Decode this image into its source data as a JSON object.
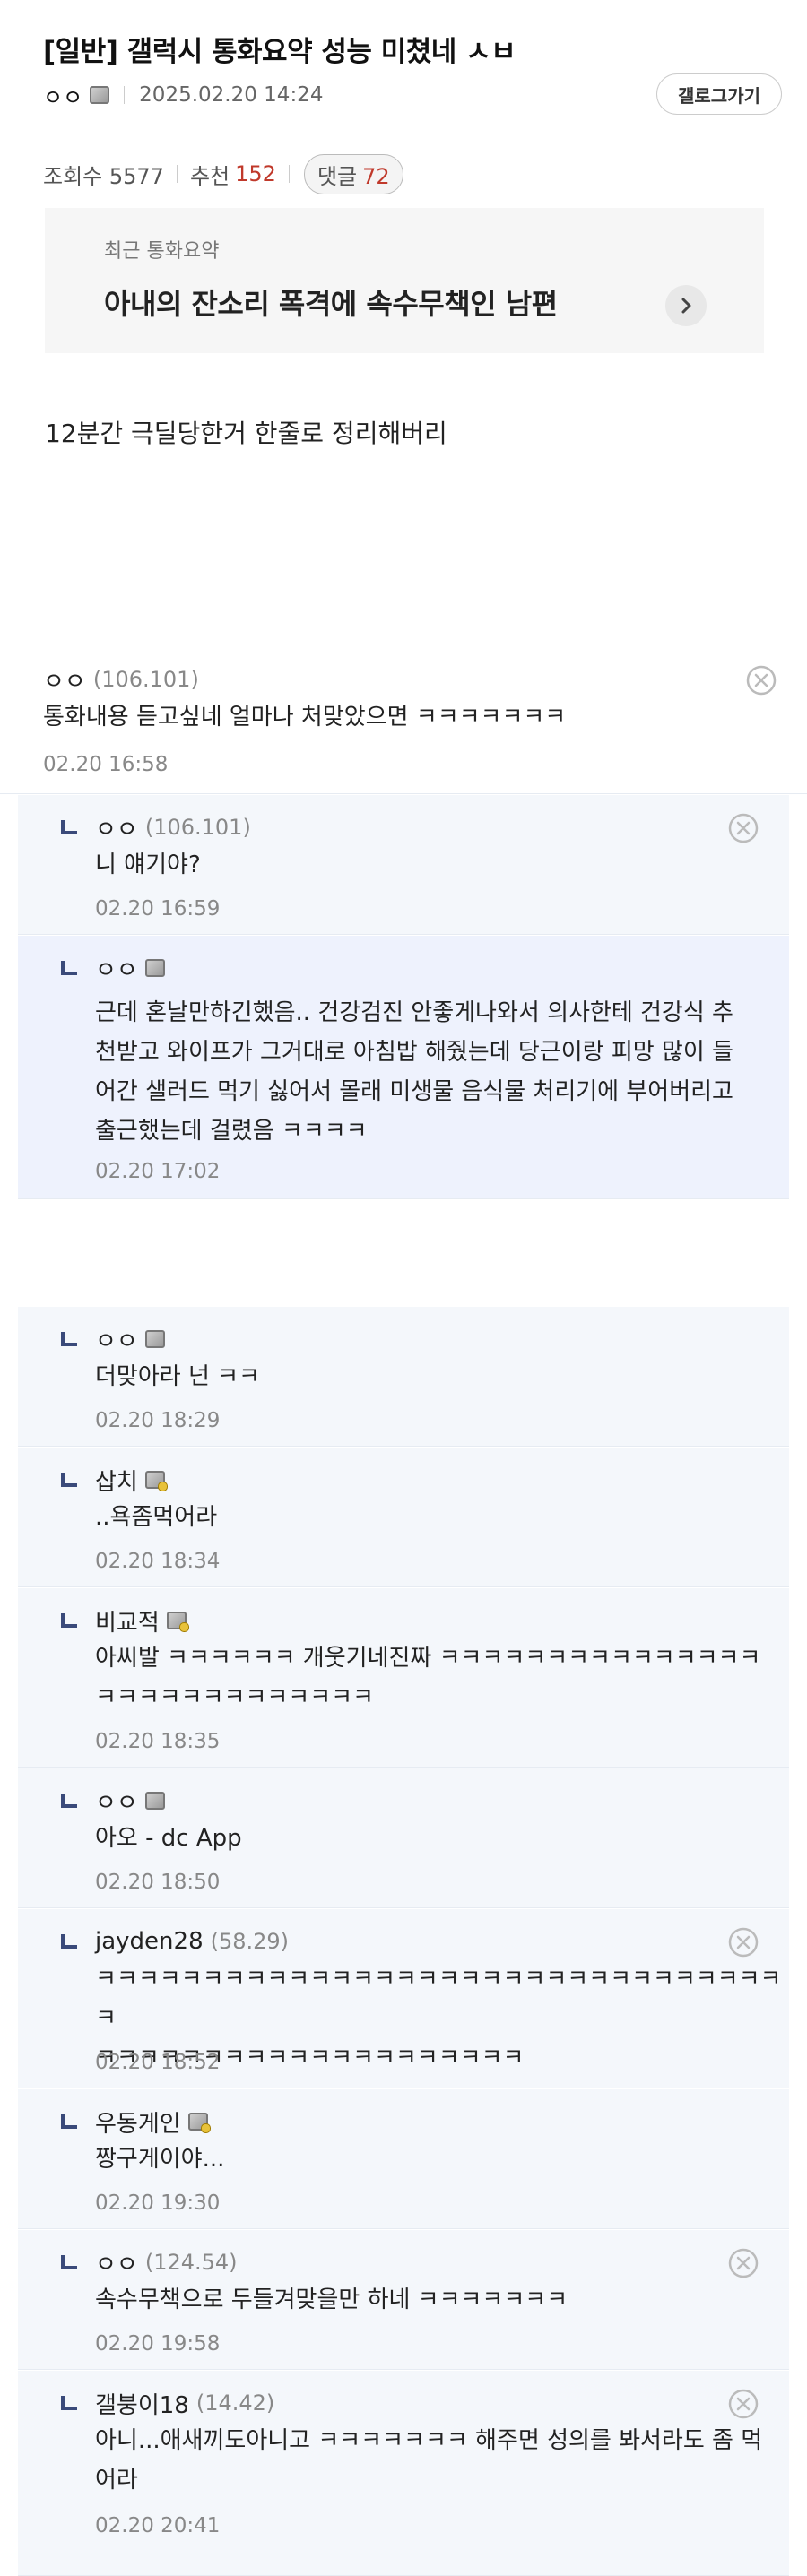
{
  "post": {
    "title": "[일반] 갤럭시 통화요약 성능 미쳤네 ㅅㅂ",
    "author": "ㅇㅇ",
    "datetime": "2025.02.20 14:24",
    "gallery_button": "갤로그가기",
    "views_label": "조회수 5577",
    "recommend_label": "추천",
    "recommend_count": "152",
    "comments_label": "댓글",
    "comments_count": "72",
    "summary_label": "최근 통화요약",
    "summary_text": "아내의 잔소리 폭격에 속수무책인 남편",
    "body": "12분간 극딜당한거 한줄로 정리해버리"
  },
  "comments": [
    {
      "nick": "ㅇㅇ",
      "ip": "(106.101)",
      "text": [
        "통화내용 듣고싶네 얼마나 처맞았으면 ㅋㅋㅋㅋㅋㅋㅋ"
      ],
      "date": "02.20 16:58"
    },
    {
      "nick": "ㅇㅇ",
      "ip": "(106.101)",
      "text": [
        "니 얘기야?"
      ],
      "date": "02.20 16:59"
    },
    {
      "nick": "ㅇㅇ",
      "ip": "",
      "text": [
        "근데 혼날만하긴했음.. 건강검진 안좋게나와서 의사한테 건강식 추",
        "천받고 와이프가 그거대로 아침밥 해줬는데 당근이랑 피망 많이 들",
        "어간 샐러드 먹기 싫어서 몰래 미생물 음식물 처리기에 부어버리고",
        "출근했는데 걸렸음 ㅋㅋㅋㅋ"
      ],
      "date": "02.20 17:02"
    },
    {
      "nick": "ㅇㅇ",
      "ip": "",
      "text": [
        "더맞아라 넌 ㅋㅋ"
      ],
      "date": "02.20 18:29"
    },
    {
      "nick": "삽치",
      "ip": "",
      "text": [
        "..욕좀먹어라"
      ],
      "date": "02.20 18:34"
    },
    {
      "nick": "비교적",
      "ip": "",
      "text": [
        "아씨발 ㅋㅋㅋㅋㅋㅋ 개웃기네진짜 ㅋㅋㅋㅋㅋㅋㅋㅋㅋㅋㅋㅋㅋㅋㅋ",
        "ㅋㅋㅋㅋㅋㅋㅋㅋㅋㅋㅋㅋㅋ"
      ],
      "date": "02.20 18:35"
    },
    {
      "nick": "ㅇㅇ",
      "ip": "",
      "text": [
        "아오 - dc App"
      ],
      "date": "02.20 18:50"
    },
    {
      "nick": "jayden28",
      "ip": "(58.29)",
      "text": [
        "ㅋㅋㅋㅋㅋㅋㅋㅋㅋㅋㅋㅋㅋㅋㅋㅋㅋㅋㅋㅋㅋㅋㅋㅋㅋㅋㅋㅋㅋㅋㅋㅋㅋ",
        "ㅋㅋㅋㅋㅋㅋㅋㅋㅋㅋㅋㅋㅋㅋㅋㅋㅋㅋㅋㅋ"
      ],
      "date": "02.20 18:52"
    },
    {
      "nick": "우동게인",
      "ip": "",
      "text": [
        "짱구게이야..."
      ],
      "date": "02.20 19:30"
    },
    {
      "nick": "ㅇㅇ",
      "ip": "(124.54)",
      "text": [
        "속수무책으로 두들겨맞을만 하네 ㅋㅋㅋㅋㅋㅋㅋ"
      ],
      "date": "02.20 19:58"
    },
    {
      "nick": "갤붕이18",
      "ip": "(14.42)",
      "text": [
        "아니...애새끼도아니고 ㅋㅋㅋㅋㅋㅋㅋ 해주면 성의를 봐서라도 좀 먹",
        "어라"
      ],
      "date": "02.20 20:41"
    }
  ]
}
